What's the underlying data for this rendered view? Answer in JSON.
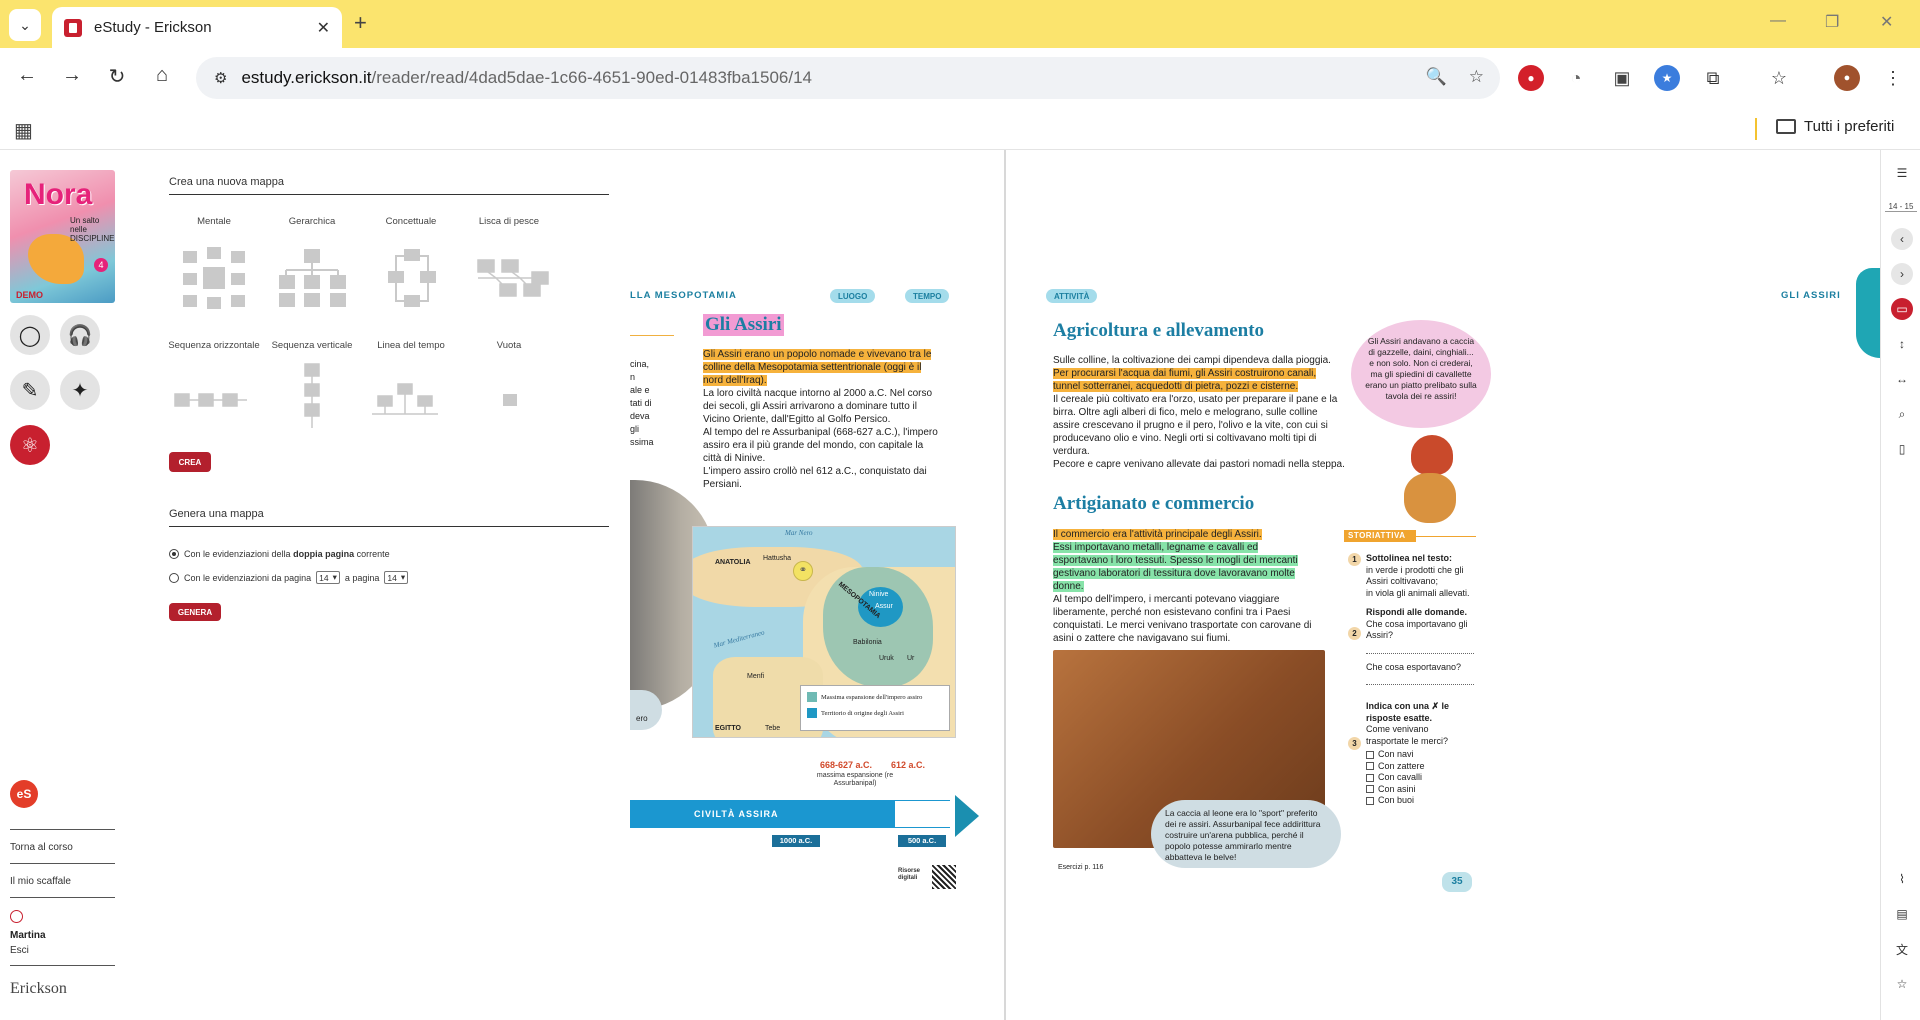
{
  "browser": {
    "tab_title": "eStudy - Erickson",
    "url_host": "estudy.erickson.it",
    "url_path": "/reader/read/4dad5dae-1c66-4651-90ed-01483fba1506/14",
    "bookmarks_folder": "Tutti i preferiti"
  },
  "book": {
    "cover_title": "Nora",
    "cover_subtitle": "Un salto nelle DISCIPLINE",
    "cover_number": "4",
    "cover_badge": "DEMO"
  },
  "rail": {
    "links": [
      "Torna al corso",
      "Il mio scaffale"
    ],
    "user_name": "Martina",
    "logout": "Esci",
    "brand": "Erickson",
    "logo_text": "eS"
  },
  "panel": {
    "create_title": "Crea una nuova mappa",
    "map_types": [
      "Mentale",
      "Gerarchica",
      "Concettuale",
      "Lisca di pesce",
      "Sequenza orizzontale",
      "Sequenza verticale",
      "Linea del tempo",
      "Vuota"
    ],
    "create_button": "CREA",
    "generate_title": "Genera una mappa",
    "option1_prefix": "Con le evidenziazioni della ",
    "option1_bold": "doppia pagina",
    "option1_suffix": " corrente",
    "option2_prefix": "Con le evidenziazioni da pagina",
    "option2_mid": "a pagina",
    "page_from": "14",
    "page_to": "14",
    "generate_button": "GENERA"
  },
  "left_page": {
    "header": "LLA MESOPOTAMIA",
    "pill_luogo": "LUOGO",
    "pill_tempo": "TEMPO",
    "title": "Gli Assiri",
    "intro_hl": "Gli Assiri erano un popolo nomade e vivevano tra le colline della Mesopotamia settentrionale (oggi è il nord dell'Iraq).",
    "p1": "La loro civiltà nacque intorno al 2000 a.C. Nel corso dei secoli, gli Assiri arrivarono a dominare tutto il Vicino Oriente, dall'Egitto al Golfo Persico.",
    "p2": "Al tempo del re Assurbanipal (668-627 a.C.), l'impero assiro era il più grande del mondo, con capitale la città di Ninive.",
    "p3": "L'impero assiro crollò nel 612 a.C., conquistato dai Persiani.",
    "cut_text": [
      "cina,",
      "n",
      "ale e",
      "tati di",
      "deva",
      "gli",
      "ssima"
    ],
    "map_labels": [
      "Hattusha",
      "ANATOLIA",
      "Mar Nero",
      "MESOPOTAMIA",
      "Ninive",
      "Assur",
      "Mar Mediterraneo",
      "Babilonia",
      "Ur",
      "Uruk",
      "Menfi",
      "EGITTO",
      "Tebe"
    ],
    "legend_1": "Massima espansione dell'impero assiro",
    "legend_2": "Territorio di origine degli Assiri",
    "tl_date1": "668-627 a.C.",
    "tl_date1_note": "massima espansione (re Assurbanipal)",
    "tl_date2": "612 a.C.",
    "tl_label": "CIVILTÀ ASSIRA",
    "tl_start": "1000 a.C.",
    "tl_end": "500 a.C.",
    "resources": "Risorse digitali",
    "bubble_cut": "ero"
  },
  "right_page": {
    "pill_attivita": "ATTIVITÀ",
    "header": "GLI ASSIRI",
    "title1": "Agricoltura e allevamento",
    "p1a": "Sulle colline, la coltivazione dei campi dipendeva dalla pioggia.",
    "p1b": "Per procurarsi l'acqua dai fiumi, gli Assiri costruirono canali, tunnel sotterranei, acquedotti di pietra, pozzi e cisterne.",
    "p1c": "Il cereale più coltivato era l'orzo, usato per preparare il pane e la birra. Oltre agli alberi di fico, melo e melograno, sulle colline assire crescevano il prugno e il pero, l'olivo e la vite, con cui si producevano olio e vino. Negli orti si coltivavano molti tipi di verdura.",
    "p1d": "Pecore e capre venivano allevate dai pastori nomadi nella steppa.",
    "title2": "Artigianato e commercio",
    "p2a": "Il commercio era l'attività principale degli Assiri.",
    "p2b": "Essi importavano metalli, legname e cavalli ed esportavano i loro tessuti. Spesso le mogli dei mercanti gestivano laboratori di tessitura dove lavoravano molte donne.",
    "p2c": "Al tempo dell'impero, i mercanti potevano viaggiare liberamente, perché non esistevano confini tra i Paesi conquistati. Le merci venivano trasportate con carovane di asini o zattere che navigavano sui fiumi.",
    "bubble": "Gli Assiri andavano a caccia di gazzelle, daini, cinghiali... e non solo. Non ci crederai, ma gli spiedini di cavallette erano un piatto prelibato sulla tavola dei re assiri!",
    "caption": "La caccia al leone era lo \"sport\" preferito dei re assiri. Assurbanipal fece addirittura costruire un'arena pubblica, perché il popolo potesse ammirarlo mentre abbatteva le belve!",
    "exercises": "Esercizi p. 116",
    "storiattiva": "STORIATTIVA",
    "q1": "Sottolinea nel testo:",
    "q1a": "in verde i prodotti che gli Assiri coltivavano;",
    "q1b": "in viola gli animali allevati.",
    "q2": "Rispondi alle domande.",
    "q2a": "Che cosa importavano gli Assiri?",
    "q2b": "Che cosa esportavano?",
    "q3": "Indica con una ✗ le risposte esatte.",
    "q3a": "Come venivano trasportate le merci?",
    "options": [
      "Con navi",
      "Con zattere",
      "Con cavalli",
      "Con asini",
      "Con buoi"
    ],
    "page_number": "35"
  },
  "right_rail": {
    "page_indicator": "14 - 15"
  },
  "colors": {
    "accent_red": "#c8202f",
    "chrome_yellow": "#fbe46e",
    "teal": "#1b8fb0",
    "title_teal": "#1c7ea3"
  }
}
